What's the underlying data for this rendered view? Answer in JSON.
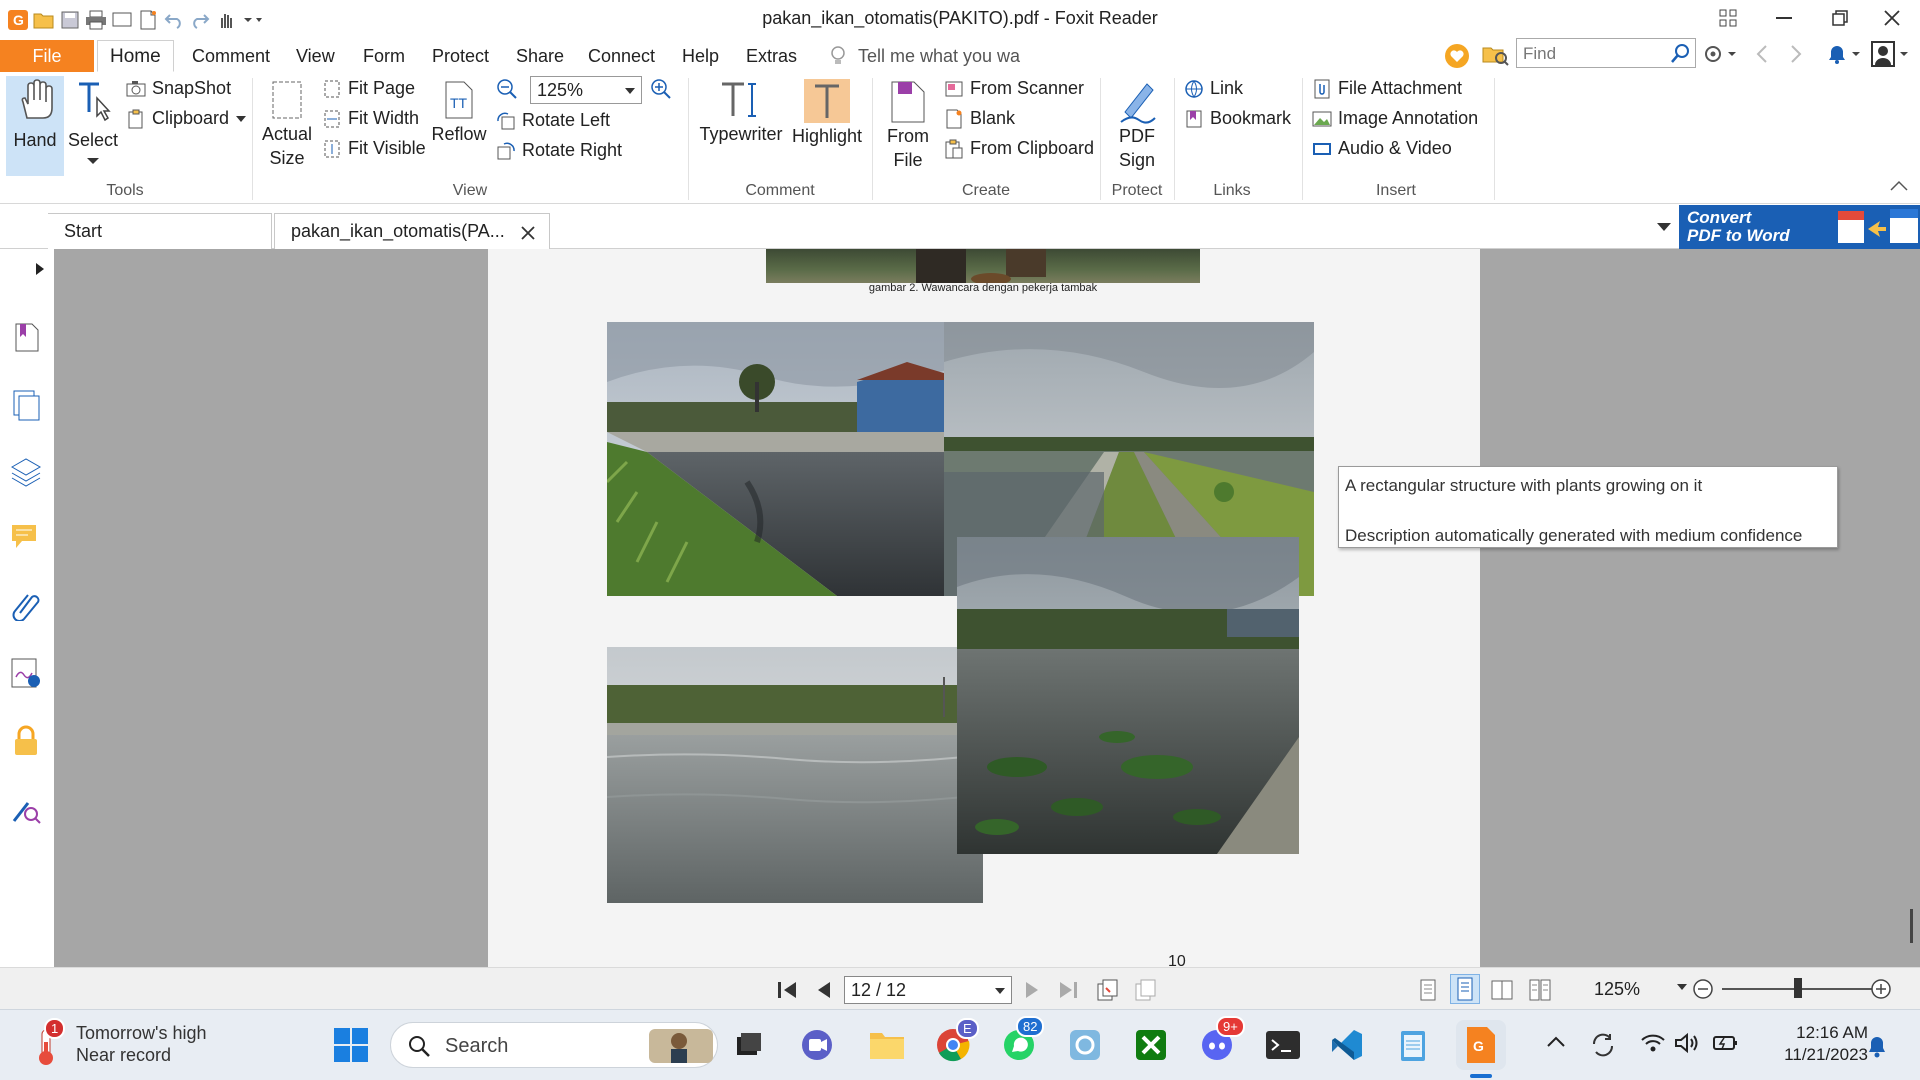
{
  "window": {
    "title": "pakan_ikan_otomatis(PAKITO).pdf - Foxit Reader"
  },
  "menu": {
    "file": "File",
    "tabs": [
      "Home",
      "Comment",
      "View",
      "Form",
      "Protect",
      "Share",
      "Connect",
      "Help",
      "Extras"
    ],
    "tell_me": "Tell me what you wa",
    "find_placeholder": "Find"
  },
  "ribbon": {
    "tools": {
      "hand": "Hand",
      "select": "Select",
      "snapshot": "SnapShot",
      "clipboard": "Clipboard",
      "group": "Tools"
    },
    "view": {
      "actual_size_1": "Actual",
      "actual_size_2": "Size",
      "fit_page": "Fit Page",
      "fit_width": "Fit Width",
      "fit_visible": "Fit Visible",
      "reflow": "Reflow",
      "zoom": "125%",
      "rotate_left": "Rotate Left",
      "rotate_right": "Rotate Right",
      "group": "View"
    },
    "comment": {
      "typewriter": "Typewriter",
      "highlight": "Highlight",
      "group": "Comment"
    },
    "create": {
      "from_file_1": "From",
      "from_file_2": "File",
      "from_scanner": "From Scanner",
      "blank": "Blank",
      "from_clipboard": "From Clipboard",
      "group": "Create"
    },
    "protect": {
      "pdf_sign_1": "PDF",
      "pdf_sign_2": "Sign",
      "group": "Protect"
    },
    "links": {
      "link": "Link",
      "bookmark": "Bookmark",
      "group": "Links"
    },
    "insert": {
      "file_attachment": "File Attachment",
      "image_annotation": "Image Annotation",
      "audio_video": "Audio & Video",
      "group": "Insert"
    }
  },
  "tabs": {
    "start": "Start",
    "document": "pakan_ikan_otomatis(PA...",
    "convert_1": "Convert",
    "convert_2": "PDF to Word"
  },
  "document": {
    "caption": "gambar 2. Wawancara dengan pekerja tambak",
    "page_number": "10",
    "tooltip_line1": "A rectangular structure with plants growing on it",
    "tooltip_line2": "Description automatically generated with medium confidence"
  },
  "statusbar": {
    "page": "12 / 12",
    "zoom": "125%"
  },
  "taskbar": {
    "weather_line1": "Tomorrow's high",
    "weather_line2": "Near record",
    "weather_badge": "1",
    "search": "Search",
    "badge_edge": "E",
    "badge_whatsapp": "82",
    "badge_discord": "9+",
    "time": "12:16 AM",
    "date": "11/21/2023"
  },
  "colors": {
    "foxit_orange": "#f58220",
    "highlight_bg": "#cde3f7",
    "doc_bg": "#a6a6a6",
    "convert_blue": "#1a5fb4"
  }
}
